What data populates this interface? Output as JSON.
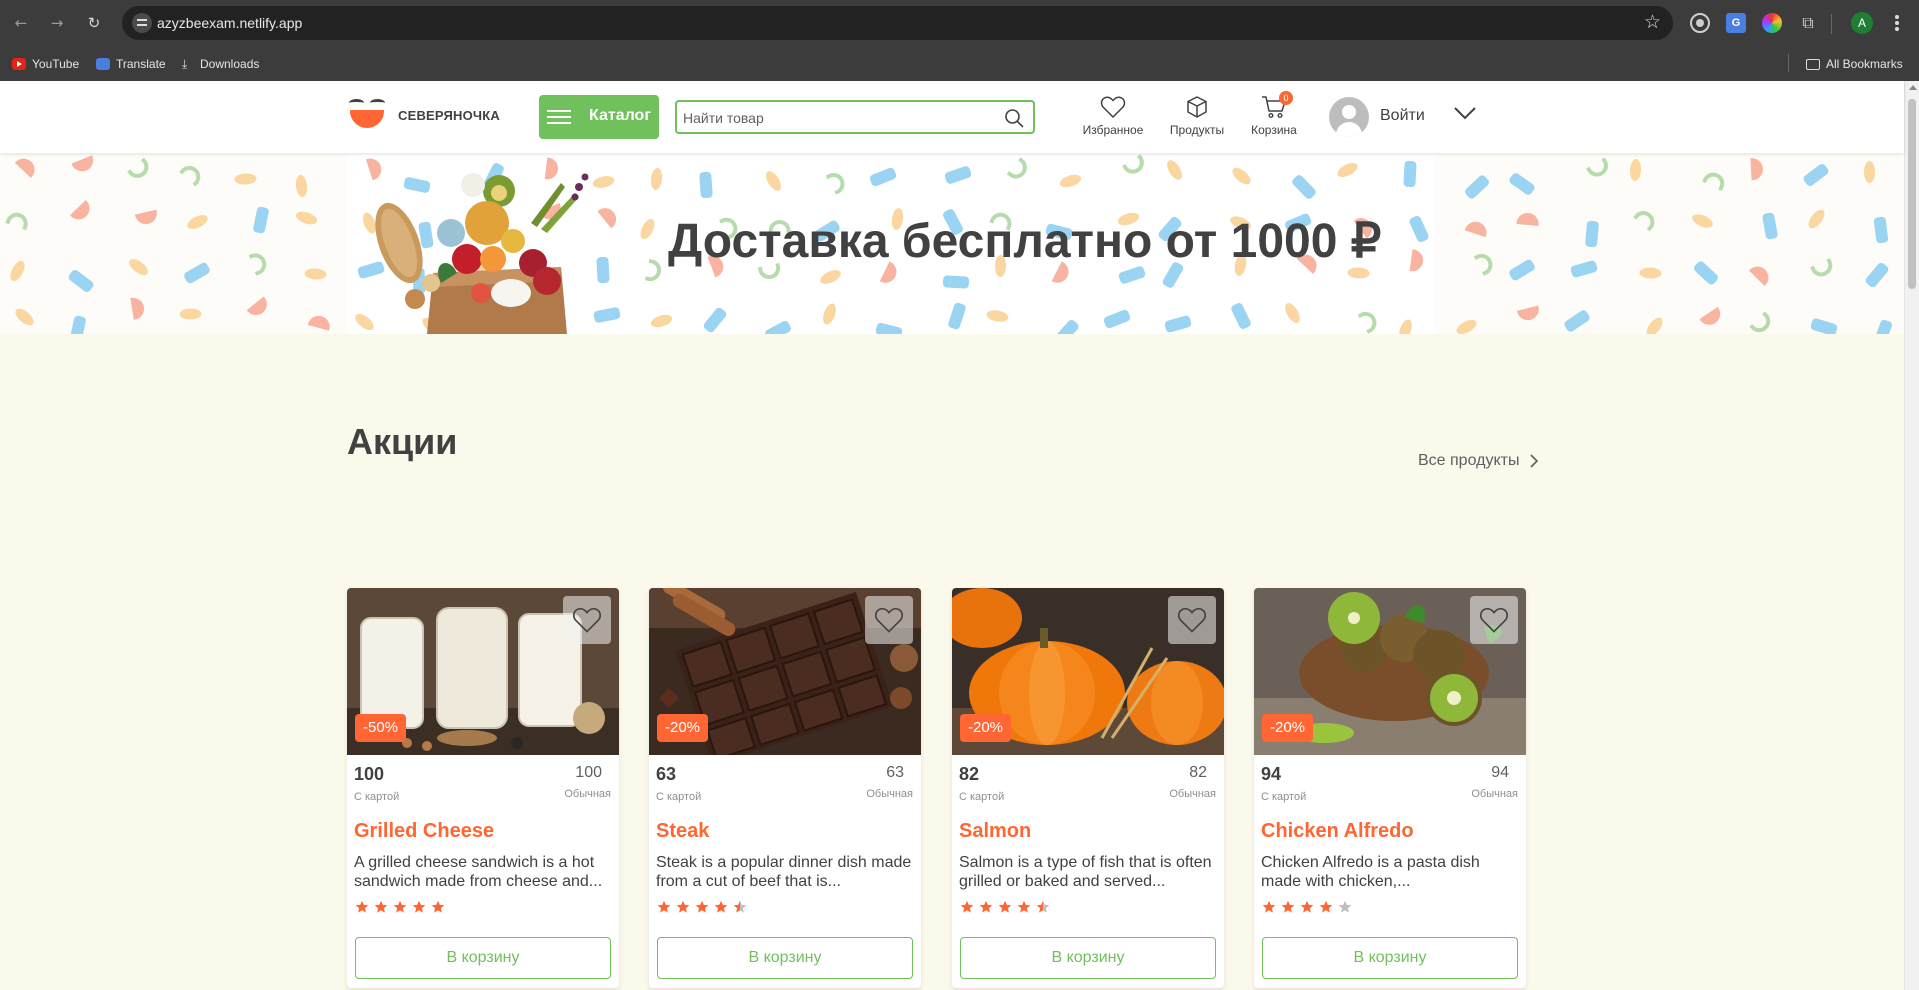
{
  "browser": {
    "url": "azyzbeexam.netlify.app",
    "profile_initial": "A",
    "bookmarks": [
      {
        "label": "YouTube",
        "icon": "youtube-icon"
      },
      {
        "label": "Translate",
        "icon": "translate-icon"
      },
      {
        "label": "Downloads",
        "icon": "download-icon"
      }
    ],
    "all_bookmarks": "All Bookmarks"
  },
  "header": {
    "logo_text": "СЕВЕРЯНОЧКА",
    "catalog_label": "Каталог",
    "search_placeholder": "Найти товар",
    "nav": [
      {
        "label": "Избранное",
        "icon": "heart-icon"
      },
      {
        "label": "Продукты",
        "icon": "box-icon"
      },
      {
        "label": "Корзина",
        "icon": "cart-icon"
      }
    ],
    "cart_count": "0",
    "login_label": "Войти"
  },
  "banner": {
    "title": "Доставка бесплатно от 1000 ₽"
  },
  "promo": {
    "title": "Акции",
    "all_link": "Все продукты",
    "cart_button_label": "В корзину",
    "card_price_label": "С картой",
    "regular_price_label": "Обычная",
    "products": [
      {
        "name": "Grilled Cheese",
        "price": "100",
        "regular": "100",
        "discount": "-50%",
        "description": "A grilled cheese sandwich is a hot sandwich made from cheese and...",
        "rating": 5,
        "image": "milk-jars"
      },
      {
        "name": "Steak",
        "price": "63",
        "regular": "63",
        "discount": "-20%",
        "description": "Steak is a popular dinner dish made from a cut of beef that is...",
        "rating": 4.5,
        "image": "chocolate"
      },
      {
        "name": "Salmon",
        "price": "82",
        "regular": "82",
        "discount": "-20%",
        "description": "Salmon is a type of fish that is often grilled or baked and served...",
        "rating": 4.5,
        "image": "pumpkins"
      },
      {
        "name": "Chicken Alfredo",
        "price": "94",
        "regular": "94",
        "discount": "-20%",
        "description": "Chicken Alfredo is a pasta dish made with chicken,...",
        "rating": 4,
        "image": "kiwi"
      }
    ]
  },
  "colors": {
    "brand_orange": "#ff6633",
    "brand_green": "#70c05b",
    "text": "#414141",
    "star_empty": "#bfbfbf"
  }
}
